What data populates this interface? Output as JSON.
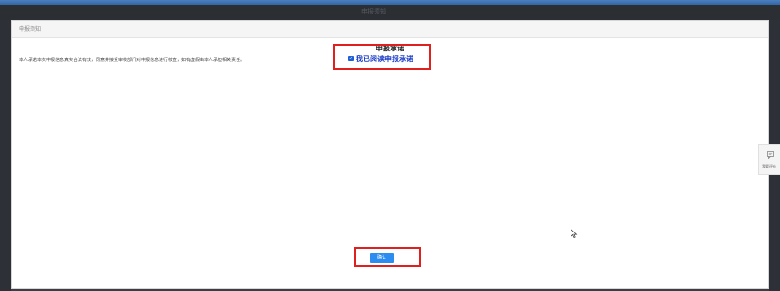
{
  "top_strip": {
    "text": "申报须知"
  },
  "dialog": {
    "title": "申报须知",
    "heading": "申报承诺",
    "promise_text": "本人承诺本次申报信息真实合法有效，同意并接受审核部门对申报信息进行核查，如有虚假由本人承担相关责任。",
    "agree_label": "我已阅读申报承诺",
    "agree_checked": true,
    "confirm_label": "确认"
  },
  "feedback": {
    "label": "我要评价",
    "icon": "comment-icon"
  },
  "colors": {
    "highlight": "#e0201e",
    "primary_button": "#2d8cf0",
    "agree_text": "#1e3ec9",
    "top_bar": "#3b6fb0"
  }
}
